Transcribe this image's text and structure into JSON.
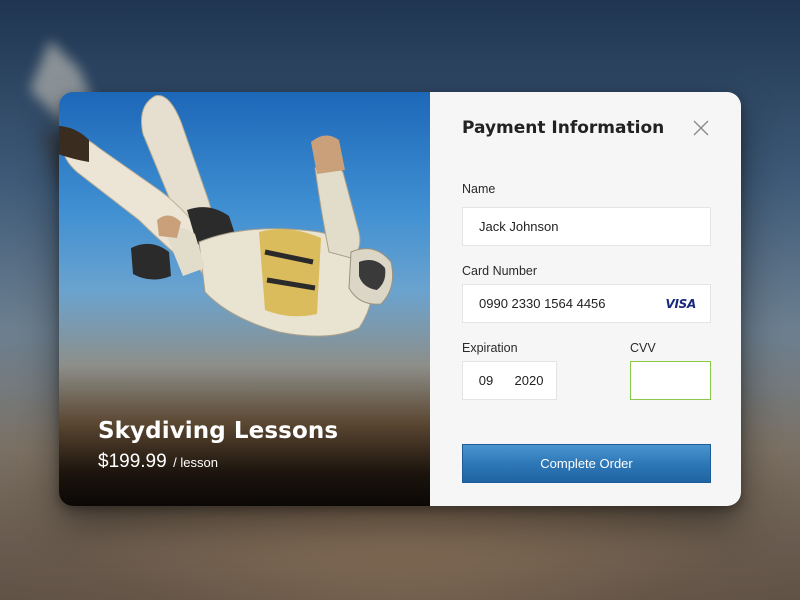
{
  "product": {
    "title": "Skydiving Lessons",
    "price": "$199.99",
    "unit": "/ lesson"
  },
  "payment": {
    "title": "Payment Information",
    "close_icon": "close-icon",
    "name": {
      "label": "Name",
      "value": "Jack Johnson"
    },
    "card": {
      "label": "Card Number",
      "value": "0990 2330 1564 4456",
      "brand": "VISA"
    },
    "expiration": {
      "label": "Expiration",
      "month": "09",
      "year": "2020"
    },
    "cvv": {
      "label": "CVV",
      "value": ""
    },
    "submit_label": "Complete Order"
  },
  "colors": {
    "accent": "#2e78b8",
    "cvv_focus_border": "#8ac94a",
    "panel_bg": "#f6f6f6",
    "visa_blue": "#1a2a7a"
  }
}
